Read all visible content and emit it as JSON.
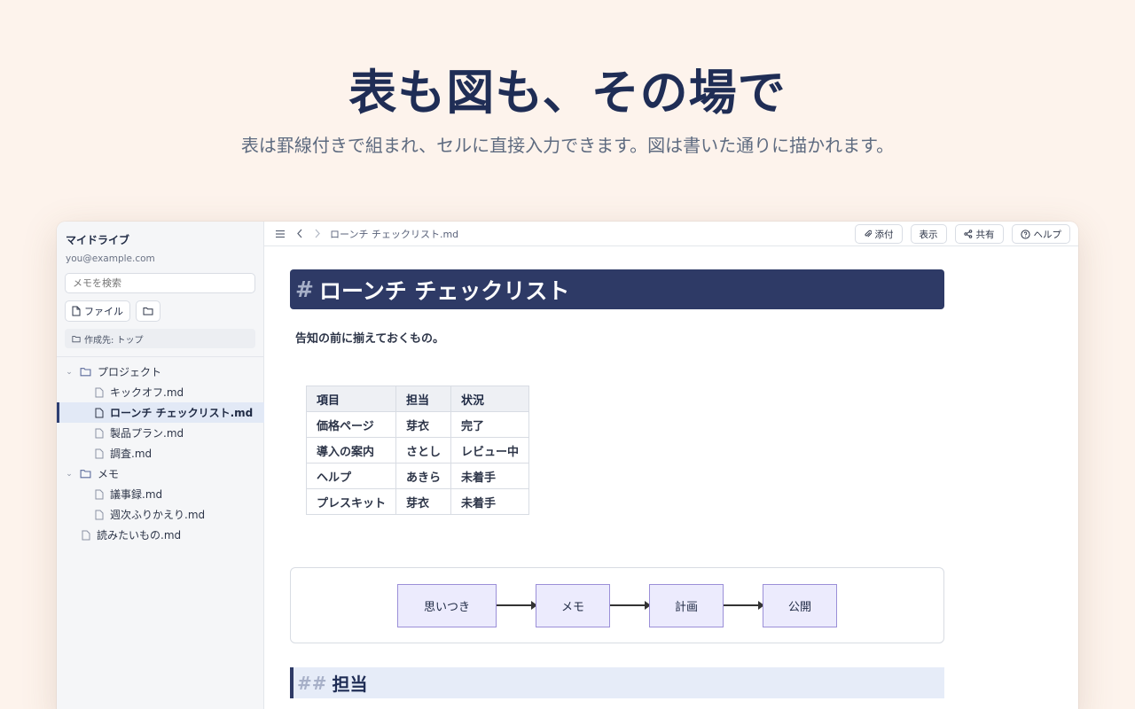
{
  "hero": {
    "title": "表も図も、その場で",
    "subtitle": "表は罫線付きで組まれ、セルに直接入力できます。図は書いた通りに描かれます。"
  },
  "sidebar": {
    "drive_label": "マイドライブ",
    "email": "you@example.com",
    "search_placeholder": "メモを検索",
    "file_button_label": "ファイル",
    "create_target": "作成先: トップ",
    "tree": [
      {
        "label": "プロジェクト",
        "type": "folder",
        "level": 0,
        "expanded": true
      },
      {
        "label": "キックオフ.md",
        "type": "file",
        "level": 1
      },
      {
        "label": "ローンチ チェックリスト.md",
        "type": "file",
        "level": 1,
        "active": true
      },
      {
        "label": "製品プラン.md",
        "type": "file",
        "level": 1
      },
      {
        "label": "調査.md",
        "type": "file",
        "level": 1
      },
      {
        "label": "メモ",
        "type": "folder",
        "level": 0,
        "expanded": true
      },
      {
        "label": "議事録.md",
        "type": "file",
        "level": 1
      },
      {
        "label": "週次ふりかえり.md",
        "type": "file",
        "level": 1
      },
      {
        "label": "読みたいもの.md",
        "type": "file",
        "level": 0
      }
    ]
  },
  "topbar": {
    "breadcrumb": "ローンチ チェックリスト.md",
    "buttons": {
      "attach": "添付",
      "view": "表示",
      "share": "共有",
      "help": "ヘルプ"
    }
  },
  "document": {
    "h1_hash": "#",
    "h1": "ローンチ チェックリスト",
    "intro": "告知の前に揃えておくもの。",
    "table": {
      "headers": [
        "項目",
        "担当",
        "状況"
      ],
      "rows": [
        [
          "価格ページ",
          "芽衣",
          "完了"
        ],
        [
          "導入の案内",
          "さとし",
          "レビュー中"
        ],
        [
          "ヘルプ",
          "あきら",
          "未着手"
        ],
        [
          "プレスキット",
          "芽衣",
          "未着手"
        ]
      ]
    },
    "flow": [
      "思いつき",
      "メモ",
      "計画",
      "公開"
    ],
    "h2_hash": "##",
    "h2": "担当"
  },
  "colors": {
    "background": "#fdf3ec",
    "heading_navy": "#2e3a66",
    "active_item": "#e2e9f6",
    "flow_node_fill": "#ecebfd",
    "flow_node_border": "#9b8fd8"
  }
}
